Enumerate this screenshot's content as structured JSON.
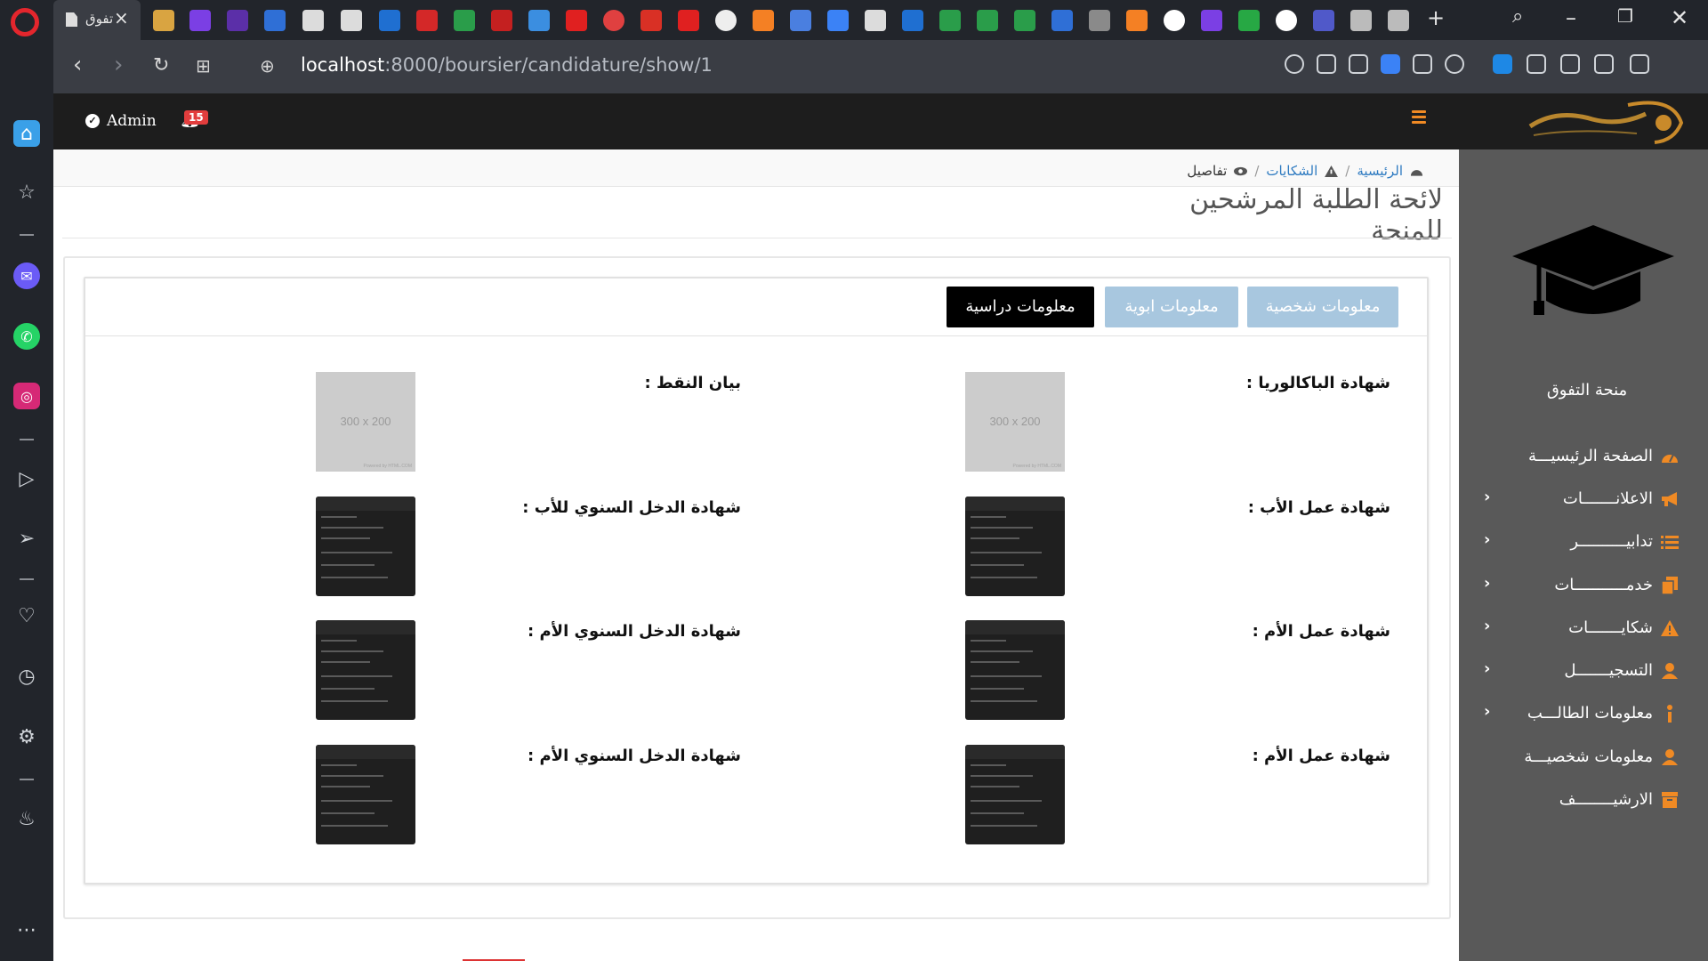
{
  "browser": {
    "active_tab_title": "تفوق",
    "url_host": "localhost",
    "url_path": ":8000/boursier/candidature/show/1"
  },
  "header": {
    "user_label": "Admin",
    "notification_count": "15"
  },
  "breadcrumb": {
    "home": "الرئيسية",
    "complaints": "الشكايات",
    "current": "تفاصيل"
  },
  "page": {
    "title": "لائحة الطلبة المرشحين للمنحة"
  },
  "tabs": {
    "personal": "معلومات شخصية",
    "parents": "معلومات ابوية",
    "study": "معلومات دراسية"
  },
  "documents": [
    {
      "label": "شهادة الباكالوريا :",
      "placeholder": "300 x 200",
      "powered": "Powered by HTML.COM"
    },
    {
      "label": "بيان النقط :",
      "placeholder": "300 x 200",
      "powered": "Powered by HTML.COM"
    },
    {
      "label": "شهادة عمل الأب :"
    },
    {
      "label": "شهادة الدخل السنوي للأب :"
    },
    {
      "label": "شهادة عمل الأم :"
    },
    {
      "label": "شهادة الدخل السنوي الأم :"
    },
    {
      "label": "شهادة عمل الأم :"
    },
    {
      "label": "شهادة الدخل السنوي الأم :"
    }
  ],
  "sidebar": {
    "title": "منحة التفوق",
    "items": [
      {
        "label": "الصفحة الرئيسيـــة",
        "icon": "dashboard-icon"
      },
      {
        "label": "الاعلانـــــــات",
        "icon": "megaphone-icon"
      },
      {
        "label": "تدابيــــــــــر",
        "icon": "list-icon"
      },
      {
        "label": "خدمـــــــــــات",
        "icon": "copy-icon"
      },
      {
        "label": "شكايـــــــات",
        "icon": "warning-icon"
      },
      {
        "label": "التسجيـــــــل",
        "icon": "user-icon"
      },
      {
        "label": "معلومات الطالـــب",
        "icon": "info-icon"
      },
      {
        "label": "معلومات شخصيـــة",
        "icon": "user-icon"
      },
      {
        "label": "الارشيــــــــف",
        "icon": "archive-icon"
      }
    ]
  },
  "colors": {
    "accent": "#f08a24",
    "sidebar_bg": "#595959",
    "header_bg": "#1d1d1d",
    "tab_inactive": "#a8c7df",
    "tab_active": "#000000",
    "link": "#2f7bc1"
  }
}
